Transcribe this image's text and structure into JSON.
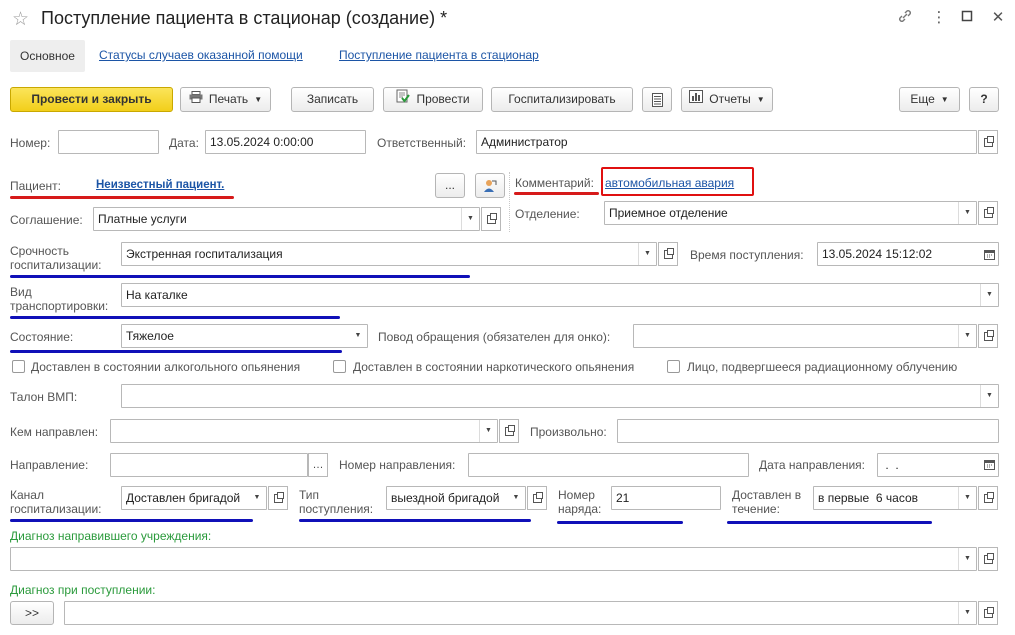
{
  "window": {
    "title": "Поступление пациента в стационар (создание) *"
  },
  "nav": {
    "tabs": [
      "Основное",
      "Статусы случаев оказанной помощи",
      "Поступление пациента в стационар"
    ]
  },
  "toolbar": {
    "post_close": "Провести и закрыть",
    "print": "Печать",
    "save": "Записать",
    "post": "Провести",
    "hospitalize": "Госпитализировать",
    "reports": "Отчеты",
    "more": "Еще",
    "help": "?"
  },
  "form": {
    "number": {
      "label": "Номер:",
      "value": ""
    },
    "date": {
      "label": "Дата:",
      "value": "13.05.2024  0:00:00"
    },
    "responsible": {
      "label": "Ответственный:",
      "value": "Администратор"
    },
    "patient": {
      "label": "Пациент:",
      "value": "Неизвестный пациент."
    },
    "dots": "...",
    "comment": {
      "label": "Комментарий:",
      "value": "автомобильная авария"
    },
    "agreement": {
      "label": "Соглашение:",
      "value": "Платные услуги"
    },
    "department": {
      "label": "Отделение:",
      "value": "Приемное отделение"
    },
    "urgency": {
      "label": "Срочность госпитализации:",
      "value": "Экстренная госпитализация"
    },
    "arrival_time": {
      "label": "Время поступления:",
      "value": "13.05.2024 15:12:02"
    },
    "transport": {
      "label": "Вид транспортировки:",
      "value": "На каталке"
    },
    "condition": {
      "label": "Состояние:",
      "value": "Тяжелое"
    },
    "reason": {
      "label": "Повод обращения (обязателен для онко):",
      "value": ""
    },
    "checkboxes": [
      "Доставлен в состоянии алкогольного опьянения",
      "Доставлен в состоянии наркотического опьянения",
      "Лицо, подвергшееся радиационному облучению"
    ],
    "vmp": {
      "label": "Талон ВМП:",
      "value": ""
    },
    "referred_by": {
      "label": "Кем направлен:",
      "value": ""
    },
    "arbitrary": {
      "label": "Произвольно:",
      "value": ""
    },
    "referral": {
      "label": "Направление:",
      "value": ""
    },
    "referral_number": {
      "label": "Номер направления:",
      "value": ""
    },
    "referral_date": {
      "label": "Дата направления:",
      "value": " .  ."
    },
    "channel": {
      "label": "Канал госпитализации:",
      "value": "Доставлен бригадой"
    },
    "admission_type": {
      "label": "Тип поступления:",
      "value": "выездной бригадой"
    },
    "order_number": {
      "label": "Номер наряда:",
      "value": "21"
    },
    "delivered_within": {
      "label": "Доставлен в течение:",
      "value": "в первые  6 часов"
    },
    "diag_referring": {
      "label": "Диагноз направившего учреждения:",
      "value": ""
    },
    "diag_admission": {
      "label": "Диагноз при поступлении:",
      "value": ""
    },
    "expand": ">>"
  }
}
